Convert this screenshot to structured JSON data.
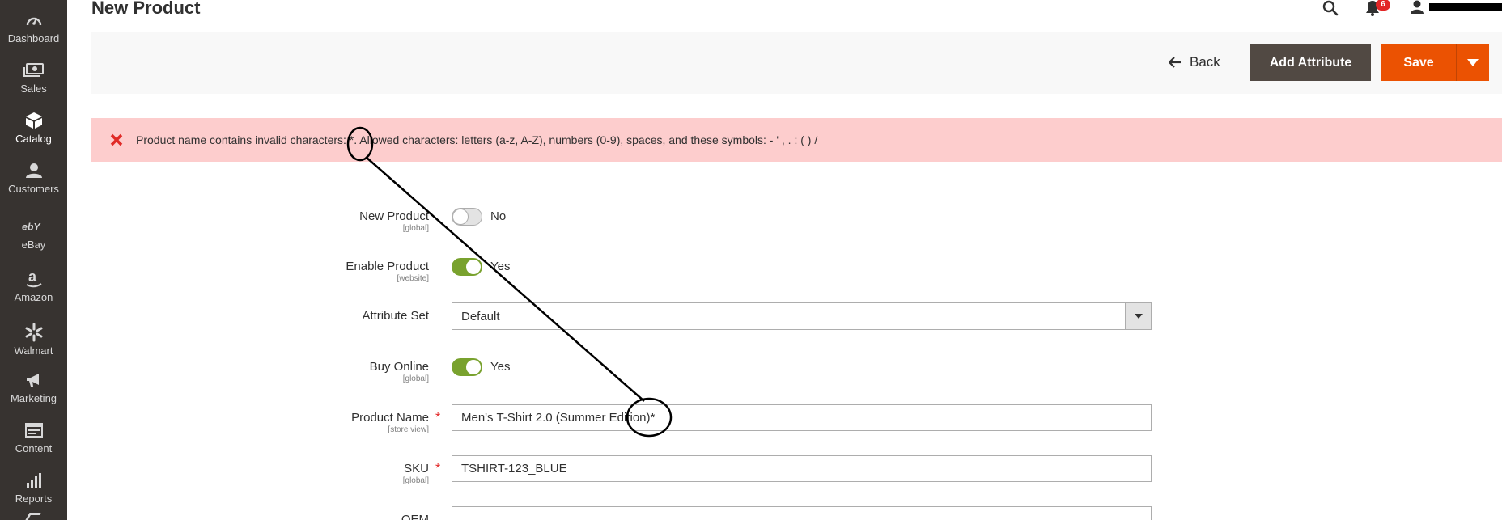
{
  "sidebar": {
    "items": [
      {
        "label": "Dashboard",
        "icon": "dashboard-icon"
      },
      {
        "label": "Sales",
        "icon": "sales-icon"
      },
      {
        "label": "Catalog",
        "icon": "catalog-icon"
      },
      {
        "label": "Customers",
        "icon": "customers-icon"
      },
      {
        "label": "eBay",
        "icon": "ebay-icon"
      },
      {
        "label": "Amazon",
        "icon": "amazon-icon"
      },
      {
        "label": "Walmart",
        "icon": "walmart-icon"
      },
      {
        "label": "Marketing",
        "icon": "marketing-icon"
      },
      {
        "label": "Content",
        "icon": "content-icon"
      },
      {
        "label": "Reports",
        "icon": "reports-icon"
      }
    ],
    "active": "Catalog",
    "background": "#373330"
  },
  "header": {
    "title": "New Product",
    "notification_count": "6"
  },
  "actions": {
    "back_label": "Back",
    "add_attribute_label": "Add Attribute",
    "save_label": "Save",
    "primary_color": "#eb5202",
    "secondary_color": "#514943"
  },
  "error": {
    "message": "Product name contains invalid characters: *. Allowed characters: letters (a-z, A-Z), numbers (0-9), spaces, and these symbols: - ' , . : ( ) /",
    "background": "#fdcdcd"
  },
  "form": {
    "new_product": {
      "label": "New Product",
      "scope": "[global]",
      "value": "No",
      "on": false
    },
    "enable_product": {
      "label": "Enable Product",
      "scope": "[website]",
      "value": "Yes",
      "on": true
    },
    "attribute_set": {
      "label": "Attribute Set",
      "value": "Default"
    },
    "buy_online": {
      "label": "Buy Online",
      "scope": "[global]",
      "value": "Yes",
      "on": true
    },
    "product_name": {
      "label": "Product Name",
      "scope": "[store view]",
      "value": "Men's T-Shirt 2.0 (Summer Edition)*",
      "required": true
    },
    "sku": {
      "label": "SKU",
      "scope": "[global]",
      "value": "TSHIRT-123_BLUE",
      "required": true
    },
    "oem": {
      "label": "OEM",
      "value": ""
    }
  }
}
